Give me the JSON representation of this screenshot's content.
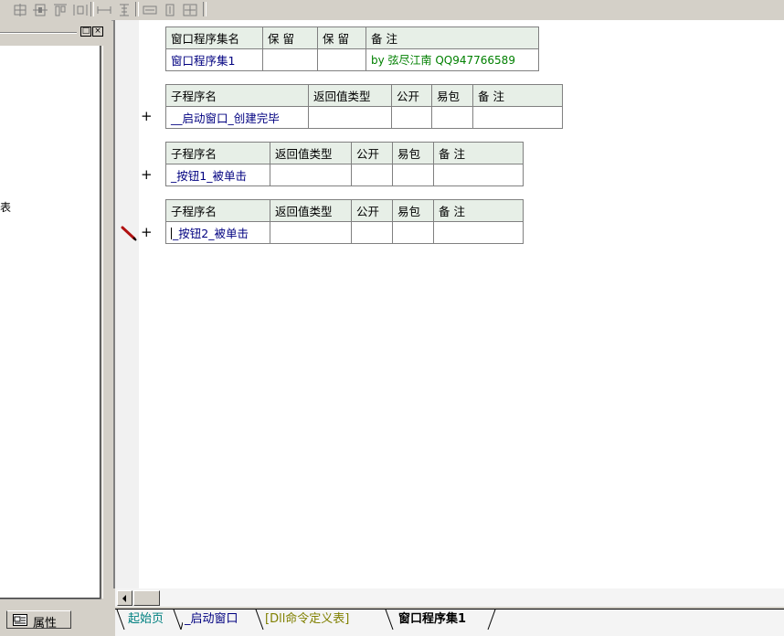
{
  "left_panel": {
    "title_buttons": [
      "□",
      "×"
    ],
    "tree_fragment": "表"
  },
  "properties_tab": {
    "label": "属性",
    "icon": "properties-icon"
  },
  "blocks": [
    {
      "headers": [
        "窗口程序集名",
        "保 留",
        "保 留",
        "备 注"
      ],
      "row": [
        "窗口程序集1",
        "",
        "",
        "by 弦尽江南 QQ947766589"
      ]
    },
    {
      "headers": [
        "子程序名",
        "返回值类型",
        "公开",
        "易包",
        "备 注"
      ],
      "row": [
        "__启动窗口_创建完毕",
        "",
        "",
        "",
        ""
      ]
    },
    {
      "headers": [
        "子程序名",
        "返回值类型",
        "公开",
        "易包",
        "备 注"
      ],
      "row": [
        "_按钮1_被单击",
        "",
        "",
        "",
        ""
      ]
    },
    {
      "headers": [
        "子程序名",
        "返回值类型",
        "公开",
        "易包",
        "备 注"
      ],
      "row": [
        "_按钮2_被单击",
        "",
        "",
        "",
        ""
      ]
    }
  ],
  "expand_symbol": "+",
  "tabs": [
    {
      "label": "起始页",
      "color": "#008080",
      "active": false
    },
    {
      "label": "_启动窗口",
      "color": "#000080",
      "active": false
    },
    {
      "label": "[Dll命令定义表]",
      "color": "#808000",
      "active": false
    },
    {
      "label": "窗口程序集1",
      "color": "#000000",
      "active": true
    }
  ],
  "colors": {
    "header_bg": "#e7efe7",
    "gutter_bg": "#f1f1f1",
    "accent_green": "#008000"
  }
}
